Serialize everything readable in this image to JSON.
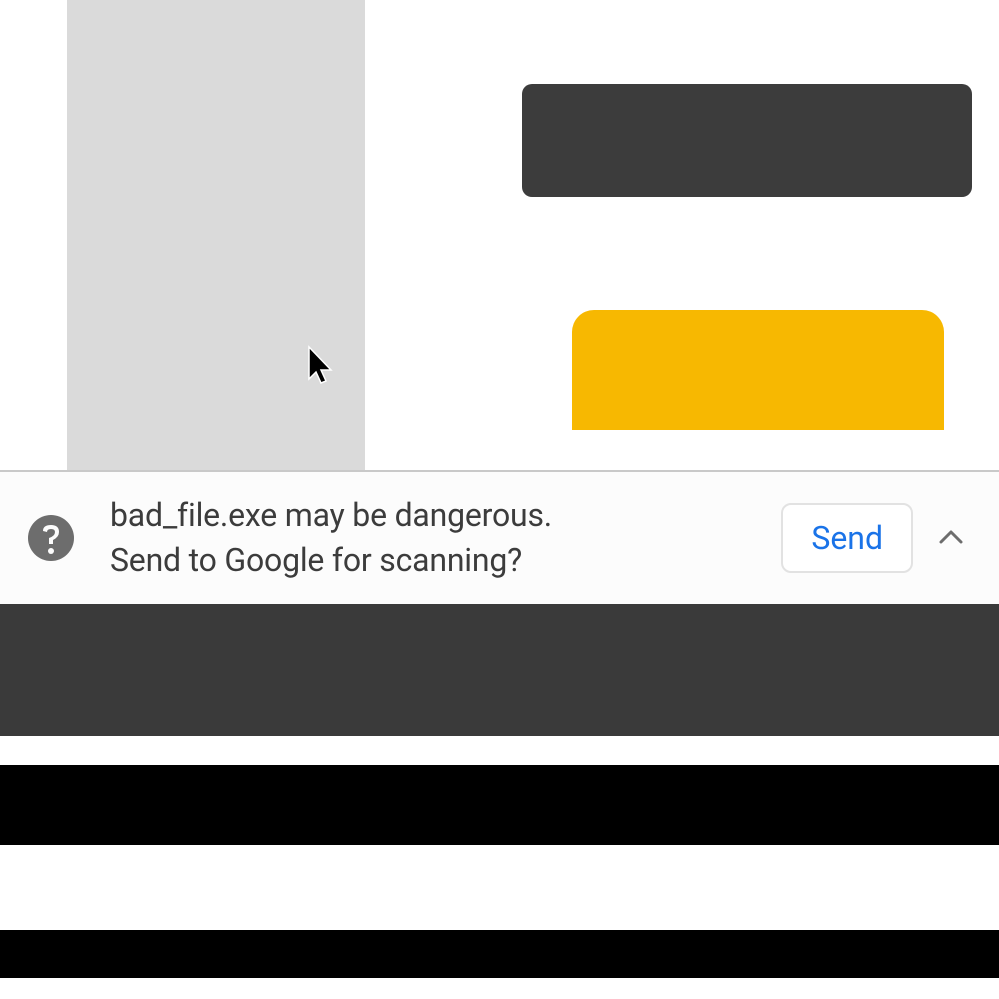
{
  "download_warning": {
    "filename": "bad_file.exe",
    "message_line1": "bad_file.exe may be dangerous.",
    "message_line2": "Send to Google for scanning?",
    "send_button_label": "Send"
  }
}
